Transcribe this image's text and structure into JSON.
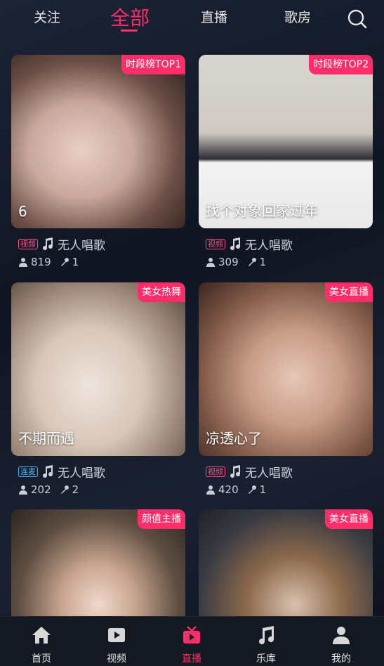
{
  "tabs": [
    {
      "label": "关注",
      "active": false
    },
    {
      "label": "全部",
      "active": true
    },
    {
      "label": "直播",
      "active": false
    },
    {
      "label": "歌房",
      "active": false
    }
  ],
  "accent": "#ff2d6a",
  "cards": [
    {
      "badge": "时段榜TOP1",
      "caption": "6",
      "tag": "视频",
      "song": "无人唱歌",
      "listeners": "819",
      "mics": "1"
    },
    {
      "badge": "时段榜TOP2",
      "caption": "找个对象回家过年",
      "tag": "视频",
      "song": "无人唱歌",
      "listeners": "309",
      "mics": "1"
    },
    {
      "badge": "美女热舞",
      "caption": "不期而遇",
      "tag": "连麦",
      "song": "无人唱歌",
      "listeners": "202",
      "mics": "2"
    },
    {
      "badge": "美女直播",
      "caption": "凉透心了",
      "tag": "视频",
      "song": "无人唱歌",
      "listeners": "420",
      "mics": "1"
    },
    {
      "badge": "颜值主播"
    },
    {
      "badge": "美女直播"
    }
  ],
  "bottom_nav": [
    {
      "label": "首页",
      "icon": "home-icon"
    },
    {
      "label": "视频",
      "icon": "video-icon"
    },
    {
      "label": "直播",
      "icon": "live-icon",
      "active": true
    },
    {
      "label": "乐库",
      "icon": "music-icon"
    },
    {
      "label": "我的",
      "icon": "user-icon"
    }
  ]
}
